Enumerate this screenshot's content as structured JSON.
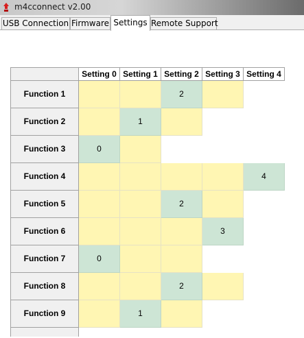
{
  "window": {
    "title": "m4cconnect v2.00",
    "icon": "red-app-icon"
  },
  "tabs": [
    {
      "label": "USB Connection",
      "active": false
    },
    {
      "label": "Firmware",
      "active": false
    },
    {
      "label": "Settings",
      "active": true
    },
    {
      "label": "Remote Support",
      "active": false
    }
  ],
  "grid": {
    "columns": [
      "Setting 0",
      "Setting 1",
      "Setting 2",
      "Setting 3",
      "Setting 4"
    ],
    "rows": [
      {
        "label": "Function 1",
        "option_count": 4,
        "selected": 2
      },
      {
        "label": "Function 2",
        "option_count": 3,
        "selected": 1
      },
      {
        "label": "Function 3",
        "option_count": 2,
        "selected": 0
      },
      {
        "label": "Function 4",
        "option_count": 5,
        "selected": 4
      },
      {
        "label": "Function 5",
        "option_count": 4,
        "selected": 2
      },
      {
        "label": "Function 6",
        "option_count": 4,
        "selected": 3
      },
      {
        "label": "Function 7",
        "option_count": 3,
        "selected": 0
      },
      {
        "label": "Function 8",
        "option_count": 4,
        "selected": 2
      },
      {
        "label": "Function 9",
        "option_count": 3,
        "selected": 1
      }
    ]
  },
  "colors": {
    "available_cell": "#fff6b3",
    "selected_cell": "#cde5d5",
    "header_bg": "#f0f0f0"
  }
}
